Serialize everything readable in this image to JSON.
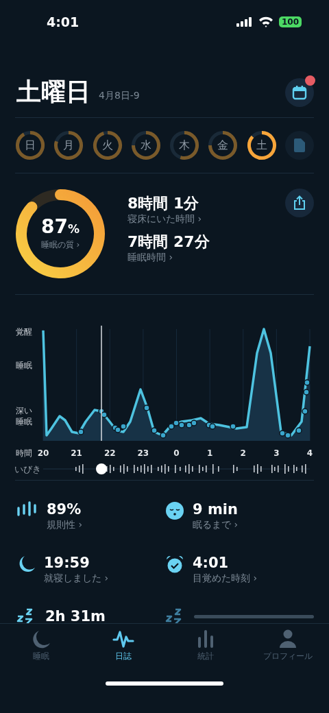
{
  "status_bar": {
    "time": "4:01",
    "battery": "100"
  },
  "header": {
    "day": "土曜日",
    "date": "4月8日-9",
    "calendar_badge": true
  },
  "week": [
    {
      "label": "日",
      "selected": false
    },
    {
      "label": "月",
      "selected": false
    },
    {
      "label": "火",
      "selected": false
    },
    {
      "label": "水",
      "selected": false
    },
    {
      "label": "木",
      "selected": false
    },
    {
      "label": "金",
      "selected": false
    },
    {
      "label": "土",
      "selected": true
    }
  ],
  "summary": {
    "quality": {
      "value": "87",
      "unit": "%",
      "label": "睡眠の質 ›"
    },
    "metrics": [
      {
        "value": "8時間 1分",
        "label": "寝床にいた時間 ›"
      },
      {
        "value": "7時間 27分",
        "label": "睡眠時間 ›"
      }
    ]
  },
  "hypnogram": {
    "y_labels": [
      "覚醒",
      "睡眠",
      "深い睡眠"
    ],
    "x_title": "時間",
    "x_labels": [
      "20",
      "21",
      "22",
      "23",
      "0",
      "1",
      "2",
      "3",
      "4"
    ],
    "snore_label": "いびき"
  },
  "stats": [
    {
      "kind": "stat",
      "value": "89%",
      "label": "規則性 ›"
    },
    {
      "kind": "stat",
      "value": "9 min",
      "label": "眠るまで ›"
    },
    {
      "kind": "stat",
      "value": "19:59",
      "label": "就寝しました ›"
    },
    {
      "kind": "stat",
      "value": "4:01",
      "label": "目覚めた時刻 ›"
    },
    {
      "kind": "stat",
      "value": "2h 31m"
    },
    {
      "kind": "loading"
    }
  ],
  "tabs": [
    {
      "label": "睡眠",
      "selected": false
    },
    {
      "label": "日誌",
      "selected": true
    },
    {
      "label": "統計",
      "selected": false
    },
    {
      "label": "プロフィール",
      "selected": false
    }
  ]
}
